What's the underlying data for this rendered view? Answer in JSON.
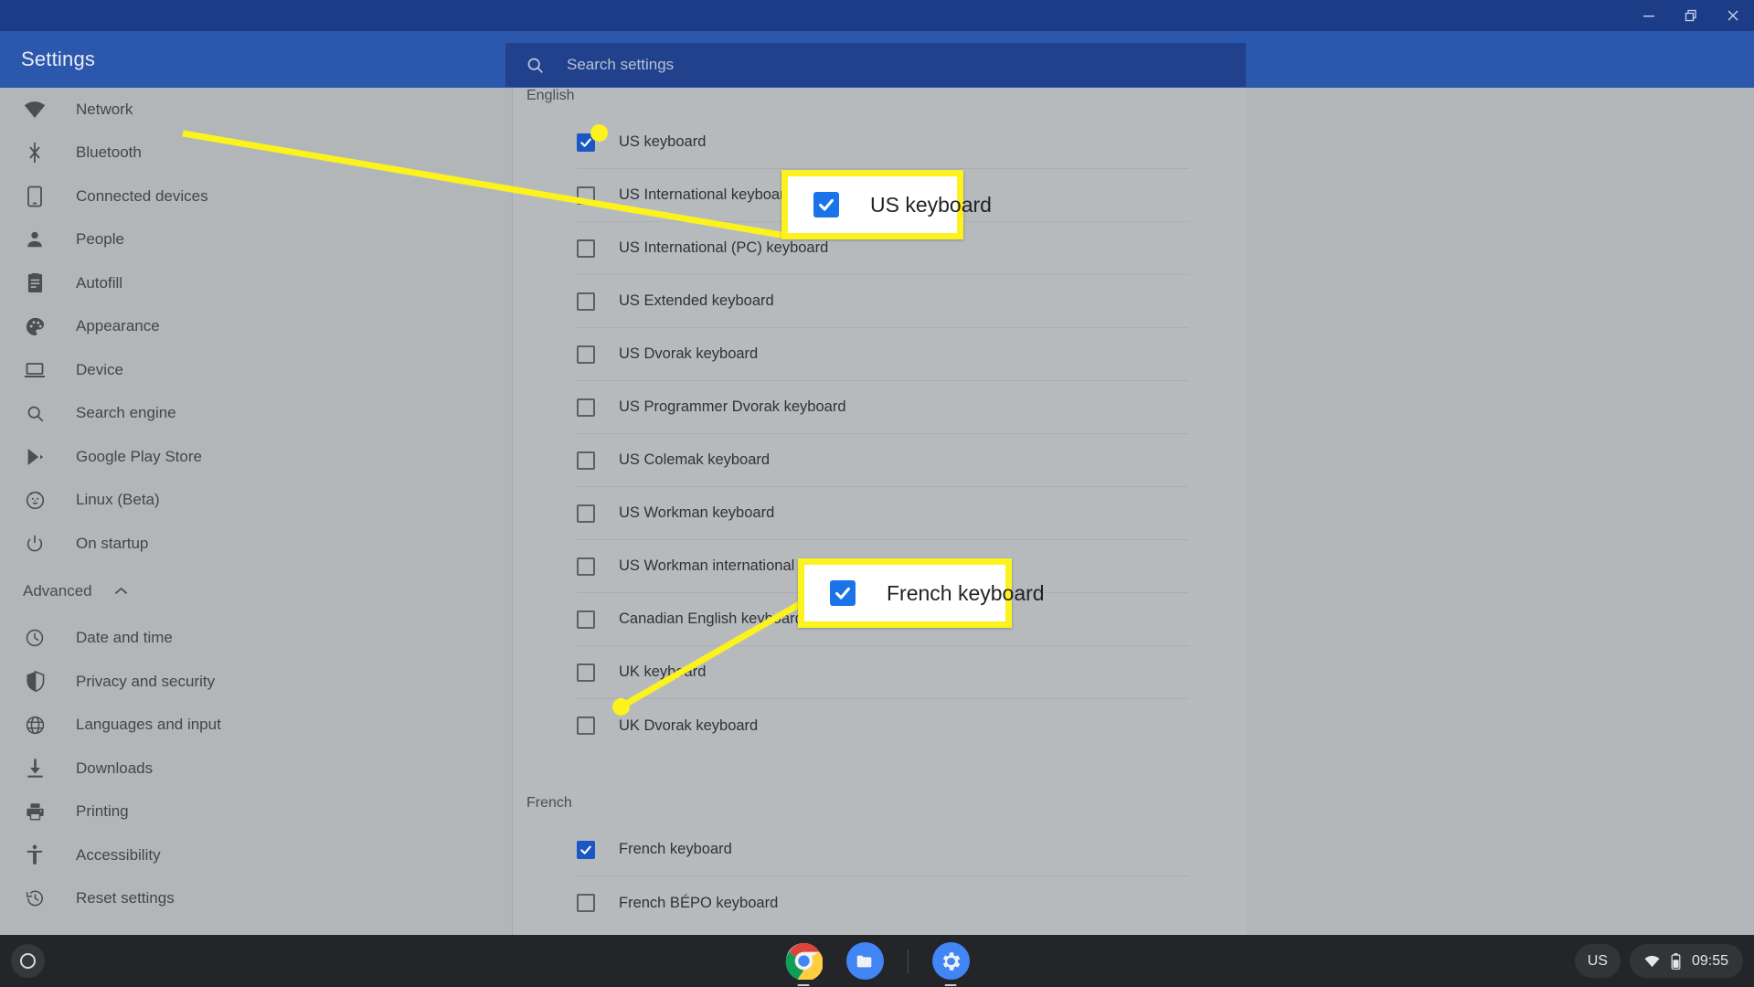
{
  "window": {
    "controls": [
      {
        "name": "minimize-button",
        "icon": "minimize-icon"
      },
      {
        "name": "maximize-button",
        "icon": "restore-icon"
      },
      {
        "name": "close-button",
        "icon": "close-icon"
      }
    ]
  },
  "header": {
    "title": "Settings",
    "search": {
      "placeholder": "Search settings",
      "value": "",
      "icon": "search-icon"
    },
    "bg_color": "#2b57ac",
    "titlebar_color": "#1c3c88"
  },
  "sidebar": {
    "items": [
      {
        "label": "Network",
        "icon": "wifi-icon"
      },
      {
        "label": "Bluetooth",
        "icon": "bluetooth-icon"
      },
      {
        "label": "Connected devices",
        "icon": "phone-icon"
      },
      {
        "label": "People",
        "icon": "person-icon"
      },
      {
        "label": "Autofill",
        "icon": "clipboard-icon"
      },
      {
        "label": "Appearance",
        "icon": "palette-icon"
      },
      {
        "label": "Device",
        "icon": "laptop-icon"
      },
      {
        "label": "Search engine",
        "icon": "search-icon"
      },
      {
        "label": "Google Play Store",
        "icon": "play-store-icon"
      },
      {
        "label": "Linux (Beta)",
        "icon": "linux-penguin-icon"
      },
      {
        "label": "On startup",
        "icon": "power-icon"
      }
    ],
    "advanced": {
      "label": "Advanced",
      "caret": "chevron-up-icon",
      "expanded": true
    },
    "advanced_items": [
      {
        "label": "Date and time",
        "icon": "clock-icon"
      },
      {
        "label": "Privacy and security",
        "icon": "shield-icon"
      },
      {
        "label": "Languages and input",
        "icon": "globe-icon"
      },
      {
        "label": "Downloads",
        "icon": "download-icon"
      },
      {
        "label": "Printing",
        "icon": "printer-icon"
      },
      {
        "label": "Accessibility",
        "icon": "accessibility-icon"
      },
      {
        "label": "Reset settings",
        "icon": "history-icon"
      }
    ]
  },
  "main": {
    "groups": [
      {
        "title": "English",
        "rows": [
          {
            "label": "US keyboard",
            "checked": true
          },
          {
            "label": "US International keyboard",
            "checked": false
          },
          {
            "label": "US International (PC) keyboard",
            "checked": false
          },
          {
            "label": "US Extended keyboard",
            "checked": false
          },
          {
            "label": "US Dvorak keyboard",
            "checked": false
          },
          {
            "label": "US Programmer Dvorak keyboard",
            "checked": false
          },
          {
            "label": "US Colemak keyboard",
            "checked": false
          },
          {
            "label": "US Workman keyboard",
            "checked": false
          },
          {
            "label": "US Workman international keyboard",
            "checked": false
          },
          {
            "label": "Canadian English keyboard",
            "checked": false
          },
          {
            "label": "UK keyboard",
            "checked": false
          },
          {
            "label": "UK Dvorak keyboard",
            "checked": false
          }
        ]
      },
      {
        "title": "French",
        "rows": [
          {
            "label": "French keyboard",
            "checked": true
          },
          {
            "label": "French BÉPO keyboard",
            "checked": false
          }
        ]
      }
    ]
  },
  "callouts": [
    {
      "label": "US keyboard",
      "checked": true,
      "border_color": "#fbf21e",
      "check_color": "#1a73e8"
    },
    {
      "label": "French keyboard",
      "checked": true,
      "border_color": "#fbf21e",
      "check_color": "#1a73e8"
    }
  ],
  "shelf": {
    "launcher": {
      "icon": "launcher-circle-icon"
    },
    "apps": [
      {
        "name": "chrome",
        "icon": "chrome-icon",
        "active": true
      },
      {
        "name": "files",
        "icon": "folder-icon",
        "active": false
      },
      {
        "name": "settings",
        "icon": "gear-icon",
        "active": true
      }
    ],
    "tray": {
      "input_method": "US",
      "wifi_icon": "wifi-icon",
      "battery_icon": "battery-icon",
      "time": "09:55"
    }
  }
}
